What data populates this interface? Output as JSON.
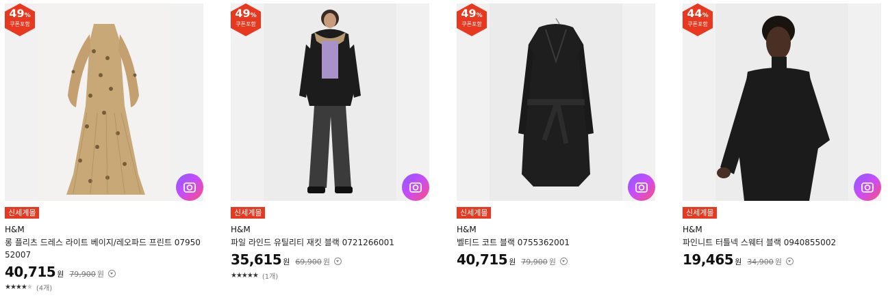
{
  "products": [
    {
      "discount": {
        "percent": "49",
        "unit": "%",
        "label": "쿠폰포함"
      },
      "tag": "신세계몰",
      "brand": "H&M",
      "name": "롱 플리츠 드레스 라이트 베이지/레오파드 프린트 0795052007",
      "price": "40,715",
      "price_unit": "원",
      "original_price": "79,900",
      "original_unit": "원",
      "rating": {
        "stars": 4,
        "max": 5,
        "count": "(4개)"
      },
      "image": "leopard-print-pleated-dress"
    },
    {
      "discount": {
        "percent": "49",
        "unit": "%",
        "label": "쿠폰포함"
      },
      "tag": "신세계몰",
      "brand": "H&M",
      "name": "파일 라인드 유틸리티 재킷 블랙 0721266001",
      "price": "35,615",
      "price_unit": "원",
      "original_price": "69,900",
      "original_unit": "원",
      "rating": {
        "stars": 5,
        "max": 5,
        "count": "(1개)"
      },
      "image": "model-in-black-parka"
    },
    {
      "discount": {
        "percent": "49",
        "unit": "%",
        "label": "쿠폰포함"
      },
      "tag": "신세계몰",
      "brand": "H&M",
      "name": "벨티드 코트 블랙 0755362001",
      "price": "40,715",
      "price_unit": "원",
      "original_price": "79,900",
      "original_unit": "원",
      "rating": null,
      "image": "black-belted-coat"
    },
    {
      "discount": {
        "percent": "44",
        "unit": "%",
        "label": "쿠폰포함"
      },
      "tag": "신세계몰",
      "brand": "H&M",
      "name": "파인니트 터틀넥 스웨터 블랙 0940855002",
      "price": "19,465",
      "price_unit": "원",
      "original_price": "34,900",
      "original_unit": "원",
      "rating": null,
      "image": "model-in-black-turtleneck"
    }
  ],
  "colors": {
    "discount_badge": "#e8381f",
    "tag_bg": "#e8381f",
    "photo_review_gradient": [
      "#8a5cff",
      "#c44dff",
      "#ff4d7d"
    ]
  },
  "icons": [
    "photo-review-icon",
    "price-info-icon",
    "star-icon"
  ]
}
